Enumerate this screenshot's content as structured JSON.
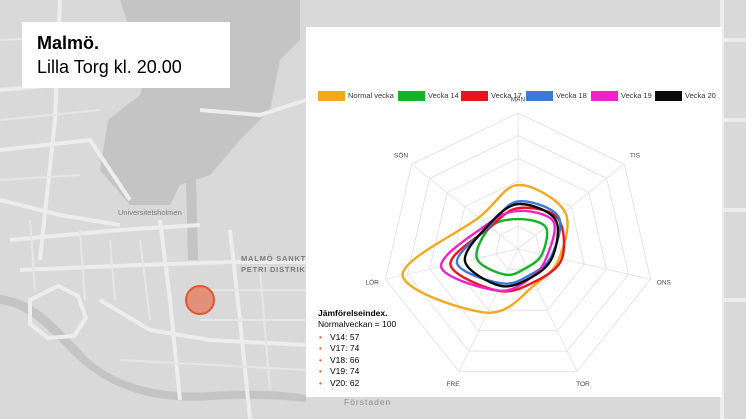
{
  "header": {
    "city": "Malmö.",
    "subtitle": "Lilla Torg kl. 20.00"
  },
  "map": {
    "labels": {
      "universitetsholmen": "Universitetsholmen",
      "district_line1": "MALMÖ SANKT",
      "district_line2": "PETRI DISTRIK",
      "forstaden": "Förstaden"
    },
    "marker_color": "#e8542a"
  },
  "chart_data": {
    "type": "radar",
    "axes": [
      "MÅN",
      "TIS",
      "ONS",
      "TOR",
      "FRE",
      "LÖR",
      "SÖN"
    ],
    "series": [
      {
        "name": "Normal vecka",
        "color": "#f4a81c",
        "values": [
          47,
          44,
          31,
          29,
          52,
          87,
          37
        ]
      },
      {
        "name": "Vecka 14",
        "color": "#12b324",
        "values": [
          22,
          26,
          18,
          15,
          21,
          31,
          26
        ]
      },
      {
        "name": "Vecka 17",
        "color": "#e8141e",
        "values": [
          30,
          37,
          33,
          27,
          34,
          51,
          26
        ]
      },
      {
        "name": "Vecka 18",
        "color": "#3d78d6",
        "values": [
          35,
          38,
          25,
          21,
          28,
          46,
          27
        ]
      },
      {
        "name": "Vecka 19",
        "color": "#ee22c8",
        "values": [
          28,
          33,
          22,
          23,
          34,
          58,
          29
        ]
      },
      {
        "name": "Vecka 20",
        "color": "#0a0a0a",
        "values": [
          33,
          35,
          26,
          23,
          30,
          40,
          28
        ]
      }
    ],
    "rlim": [
      0,
      100
    ],
    "grid": true,
    "legend_position": "top"
  },
  "index": {
    "title": "Jämförelseindex.",
    "baseline": "Normalveckan = 100",
    "bullet": "•",
    "items": [
      "V14: 57",
      "V17: 74",
      "V18: 66",
      "V19: 74",
      "V20: 62"
    ]
  }
}
